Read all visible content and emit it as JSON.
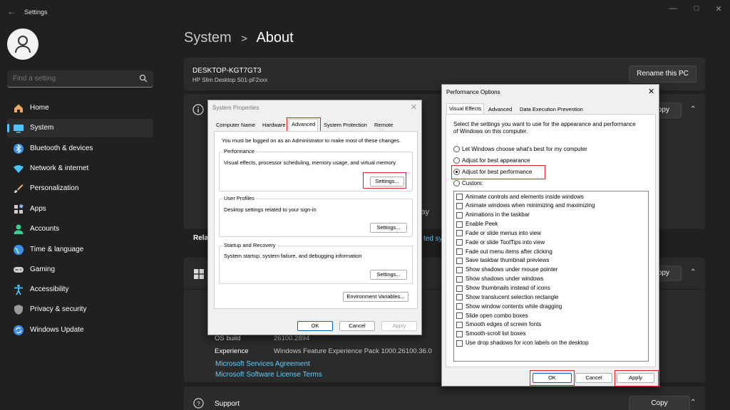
{
  "app": {
    "title": "Settings",
    "window_controls": [
      "minimize-icon",
      "maximize-icon",
      "close-icon"
    ]
  },
  "search": {
    "placeholder": "Find a setting"
  },
  "sidebar": {
    "items": [
      {
        "label": "Home",
        "icon": "home-icon"
      },
      {
        "label": "System",
        "icon": "system-icon",
        "active": true
      },
      {
        "label": "Bluetooth & devices",
        "icon": "bluetooth-icon"
      },
      {
        "label": "Network & internet",
        "icon": "wifi-icon"
      },
      {
        "label": "Personalization",
        "icon": "brush-icon"
      },
      {
        "label": "Apps",
        "icon": "apps-icon"
      },
      {
        "label": "Accounts",
        "icon": "accounts-icon"
      },
      {
        "label": "Time & language",
        "icon": "globe-icon"
      },
      {
        "label": "Gaming",
        "icon": "gamepad-icon"
      },
      {
        "label": "Accessibility",
        "icon": "accessibility-icon"
      },
      {
        "label": "Privacy & security",
        "icon": "shield-icon"
      },
      {
        "label": "Windows Update",
        "icon": "update-icon"
      }
    ]
  },
  "header": {
    "crumb": "System",
    "separator": ">",
    "title": "About"
  },
  "device": {
    "name": "DESKTOP-KGT7GT3",
    "model": "HP Slim Desktop S01-pF2xxx",
    "rename_label": "Rename this PC"
  },
  "bg_partial": {
    "copy_label_1": "opy",
    "copy_label_2": "opy",
    "lay": "lay",
    "rela": "Rela",
    "ted_sys": "ted sys"
  },
  "windows_spec": {
    "rows": [
      {
        "label": "OS build",
        "value": "26100.2894"
      },
      {
        "label": "Experience",
        "value": "Windows Feature Experience Pack 1000.26100.36.0"
      }
    ],
    "links": [
      "Microsoft Services Agreement",
      "Microsoft Software License Terms"
    ]
  },
  "support": {
    "label": "Support",
    "copy_label": "Copy"
  },
  "system_properties": {
    "title": "System Properties",
    "tabs": [
      "Computer Name",
      "Hardware",
      "Advanced",
      "System Protection",
      "Remote"
    ],
    "admin_note": "You must be logged on as an Administrator to make most of these changes.",
    "performance": {
      "label": "Performance",
      "desc": "Visual effects, processor scheduling, memory usage, and virtual memory",
      "button": "Settings..."
    },
    "profiles": {
      "label": "User Profiles",
      "desc": "Desktop settings related to your sign-in",
      "button": "Settings..."
    },
    "startup": {
      "label": "Startup and Recovery",
      "desc": "System startup, system failure, and debugging information",
      "button": "Settings..."
    },
    "env_button": "Environment Variables...",
    "ok": "OK",
    "cancel": "Cancel",
    "apply": "Apply"
  },
  "performance_options": {
    "title": "Performance Options",
    "tabs": [
      "Visual Effects",
      "Advanced",
      "Data Execution Prevention"
    ],
    "intro": "Select the settings you want to use for the appearance and performance of Windows on this computer.",
    "radios": [
      {
        "label": "Let Windows choose what's best for my computer",
        "selected": false
      },
      {
        "label": "Adjust for best appearance",
        "selected": false
      },
      {
        "label": "Adjust for best performance",
        "selected": true
      },
      {
        "label": "Custom:",
        "selected": false
      }
    ],
    "checkboxes": [
      "Animate controls and elements inside windows",
      "Animate windows when minimizing and maximizing",
      "Animations in the taskbar",
      "Enable Peek",
      "Fade or slide menus into view",
      "Fade or slide ToolTips into view",
      "Fade out menu items after clicking",
      "Save taskbar thumbnail previews",
      "Show shadows under mouse pointer",
      "Show shadows under windows",
      "Show thumbnails instead of icons",
      "Show translucent selection rectangle",
      "Show window contents while dragging",
      "Slide open combo boxes",
      "Smooth edges of screen fonts",
      "Smooth-scroll list boxes",
      "Use drop shadows for icon labels on the desktop"
    ],
    "ok": "OK",
    "cancel": "Cancel",
    "apply": "Apply"
  },
  "colors": {
    "accent": "#4cc2ff",
    "link": "#60cdff",
    "highlight": "#e02020"
  }
}
